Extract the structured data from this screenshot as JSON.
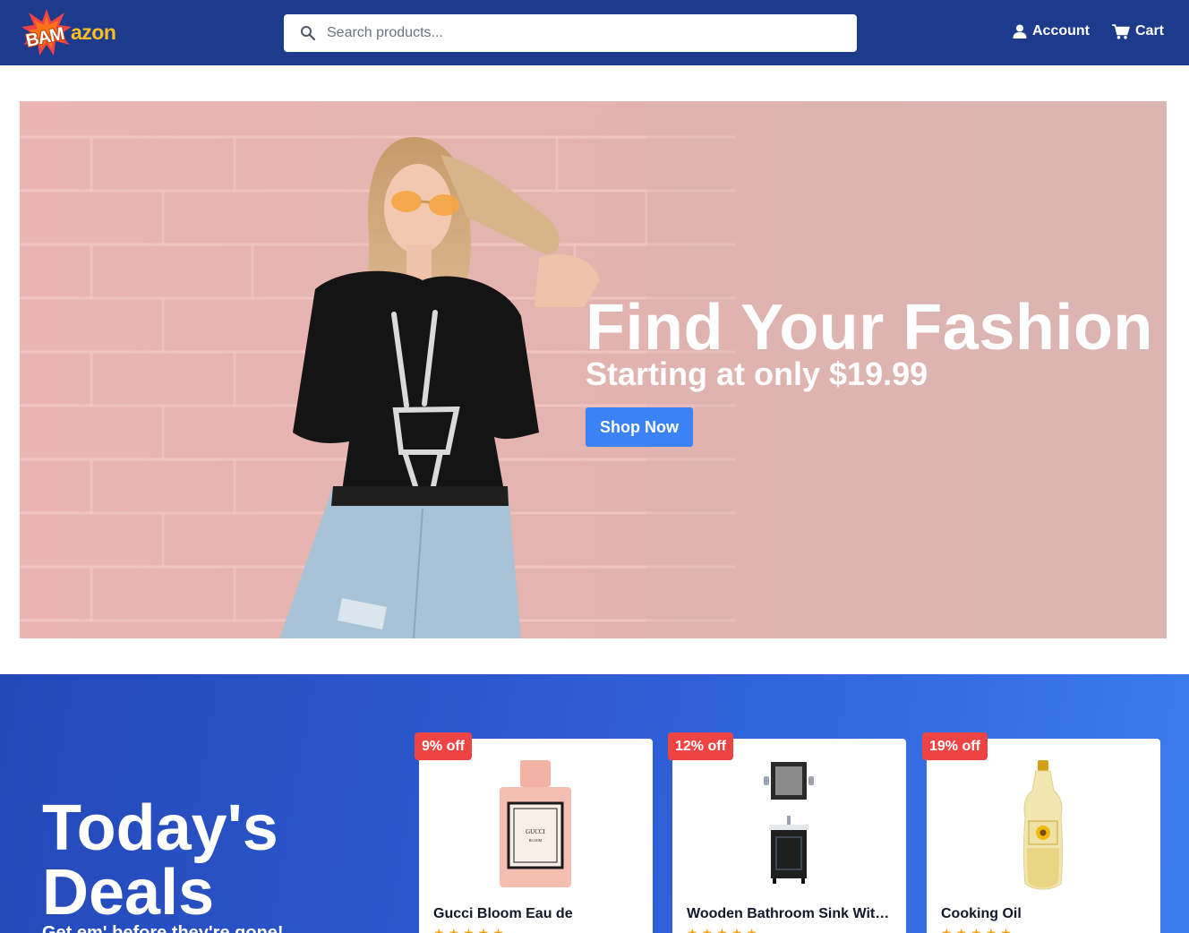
{
  "header": {
    "logo_left": "BAM",
    "logo_right": "azon",
    "search_placeholder": "Search products...",
    "account_label": "Account",
    "cart_label": "Cart"
  },
  "hero": {
    "title": "Find Your Fashion",
    "subtitle": "Starting at only $19.99",
    "button_label": "Shop Now"
  },
  "deals": {
    "title": "Today's Deals",
    "subtitle": "Get em' before they're gone!",
    "items": [
      {
        "discount": "9% off",
        "name": "Gucci Bloom Eau de",
        "rating": 5
      },
      {
        "discount": "12% off",
        "name": "Wooden Bathroom Sink With Mirror",
        "rating": 5
      },
      {
        "discount": "19% off",
        "name": "Cooking Oil",
        "rating": 5
      }
    ]
  },
  "colors": {
    "header": "#1e3a8a",
    "accent": "#3b82f6",
    "badge": "#ef4444",
    "logo_yellow": "#fbbf24"
  },
  "icons": [
    "search-icon",
    "user-icon",
    "cart-icon",
    "star-icon"
  ]
}
